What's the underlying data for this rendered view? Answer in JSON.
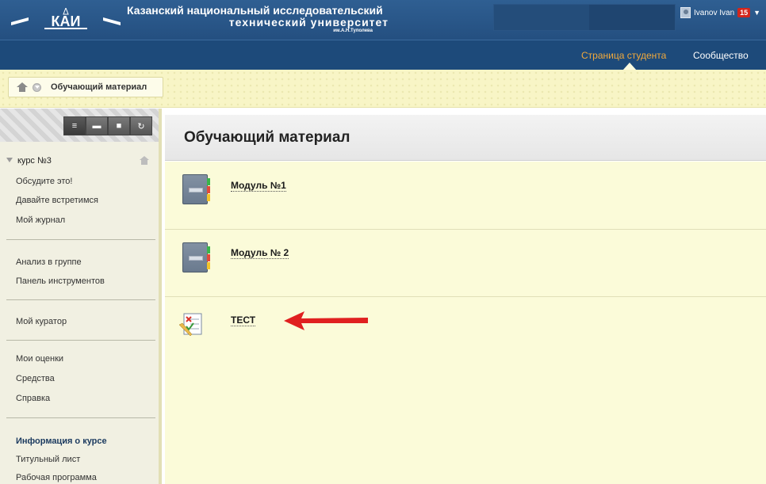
{
  "header": {
    "university_line1": "Казанский национальный исследовательский",
    "university_line2": "технический университет",
    "university_line3": "им.А.Н.Туполева",
    "user_name": "Ivanov Ivan",
    "notification_count": "15"
  },
  "nav": {
    "active_tab": "Страница студента",
    "other_tab": "Сообщество"
  },
  "breadcrumb": {
    "current": "Обучающий материал"
  },
  "sidebar": {
    "course_title": "курс №3",
    "group1": [
      "Обсудите это!",
      "Давайте встретимся",
      "Мой журнал"
    ],
    "group2": [
      "Анализ в группе",
      "Панель инструментов"
    ],
    "group3": [
      "Мой куратор"
    ],
    "group4": [
      "Мои оценки",
      "Средства",
      "Справка"
    ],
    "group5_heading": "Информация о курсе",
    "group5": [
      "Титульный лист",
      "Рабочая программа"
    ]
  },
  "content": {
    "title": "Обучающий материал",
    "items": [
      {
        "label": "Модуль №1",
        "type": "module-icon"
      },
      {
        "label": "Модуль № 2",
        "type": "module-icon"
      },
      {
        "label": "ТЕСТ",
        "type": "test-icon"
      }
    ]
  }
}
